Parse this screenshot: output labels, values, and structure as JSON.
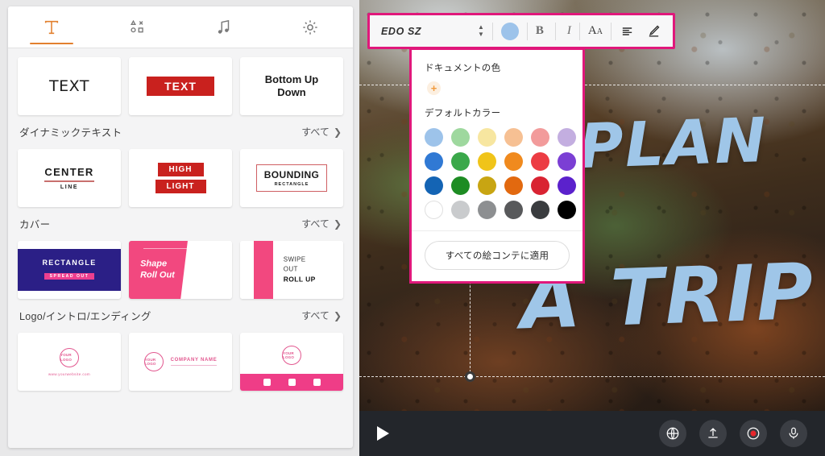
{
  "left_panel": {
    "tabs": [
      {
        "name": "text",
        "icon": "text-tool-icon",
        "active": true
      },
      {
        "name": "shapes",
        "icon": "shapes-tool-icon",
        "active": false
      },
      {
        "name": "music",
        "icon": "music-note-icon",
        "active": false
      },
      {
        "name": "settings",
        "icon": "gear-icon",
        "active": false
      }
    ],
    "sections": [
      {
        "title": "",
        "all_label": "",
        "items": [
          {
            "kind": "plain-text",
            "label": "TEXT"
          },
          {
            "kind": "boxed-text",
            "label": "TEXT"
          },
          {
            "kind": "stacked-text",
            "line1": "Bottom Up",
            "line2": "Down"
          }
        ]
      },
      {
        "title": "ダイナミックテキスト",
        "all_label": "すべて",
        "items": [
          {
            "kind": "center-line",
            "line1": "CENTER",
            "line2": "LINE"
          },
          {
            "kind": "highlight",
            "line1": "HIGH",
            "line2": "LIGHT"
          },
          {
            "kind": "bounding",
            "line1": "BOUNDING",
            "line2": "RECTANGLE"
          }
        ]
      },
      {
        "title": "カバー",
        "all_label": "すべて",
        "items": [
          {
            "kind": "rect-spread",
            "line1": "RECTANGLE",
            "line2": "SPREAD OUT"
          },
          {
            "kind": "shape-roll",
            "line1": "Shape",
            "line2": "Roll Out"
          },
          {
            "kind": "swipe-roll",
            "line1": "SWIPE",
            "line2": "OUT",
            "line3": "ROLL UP"
          }
        ]
      },
      {
        "title": "Logo/イントロ/エンディング",
        "all_label": "すべて",
        "items": [
          {
            "kind": "logo-url",
            "logo": "YOUR LOGO",
            "url": "www.yourwebsite.com"
          },
          {
            "kind": "logo-company",
            "logo": "YOUR LOGO",
            "company": "COMPANY NAME"
          },
          {
            "kind": "logo-social",
            "logo": "YOUR LOGO"
          }
        ]
      }
    ],
    "chevron": "❯"
  },
  "toolbar": {
    "font_name": "EDO SZ",
    "spinner_up": "▲",
    "spinner_down": "▼",
    "color_swatch": "#9dc3ea",
    "bold_label": "B",
    "italic_label": "I",
    "font_size_label": "A",
    "font_size_small": "A",
    "align_icon": "align-left-icon",
    "pen_icon": "pen-icon",
    "border_color": "#e0187b"
  },
  "color_popup": {
    "document_color_label": "ドキュメントの色",
    "add_color_label": "+",
    "default_color_label": "デフォルトカラー",
    "apply_button_label": "すべての絵コンテに適用",
    "swatches": [
      "#9dc3ea",
      "#9ed89e",
      "#f7e6a0",
      "#f6c093",
      "#f29b9b",
      "#c3aee0",
      "#3079d4",
      "#3aa84a",
      "#f0c419",
      "#f08a1e",
      "#ec3c43",
      "#7b3fd4",
      "#1464b4",
      "#1d8c23",
      "#c8a512",
      "#e2690f",
      "#d92332",
      "#5b21cc",
      "#ffffff",
      "#c9cbcd",
      "#8d8f91",
      "#58595b",
      "#3a3c3f",
      "#000000"
    ]
  },
  "canvas": {
    "text_lines": [
      "PLAN",
      "A TRIP"
    ],
    "text_color": "#9fc6e8"
  },
  "playbar": {
    "play_icon": "play-icon",
    "buttons": [
      {
        "name": "globe-icon"
      },
      {
        "name": "upload-icon"
      },
      {
        "name": "record-icon"
      },
      {
        "name": "microphone-icon"
      }
    ]
  }
}
